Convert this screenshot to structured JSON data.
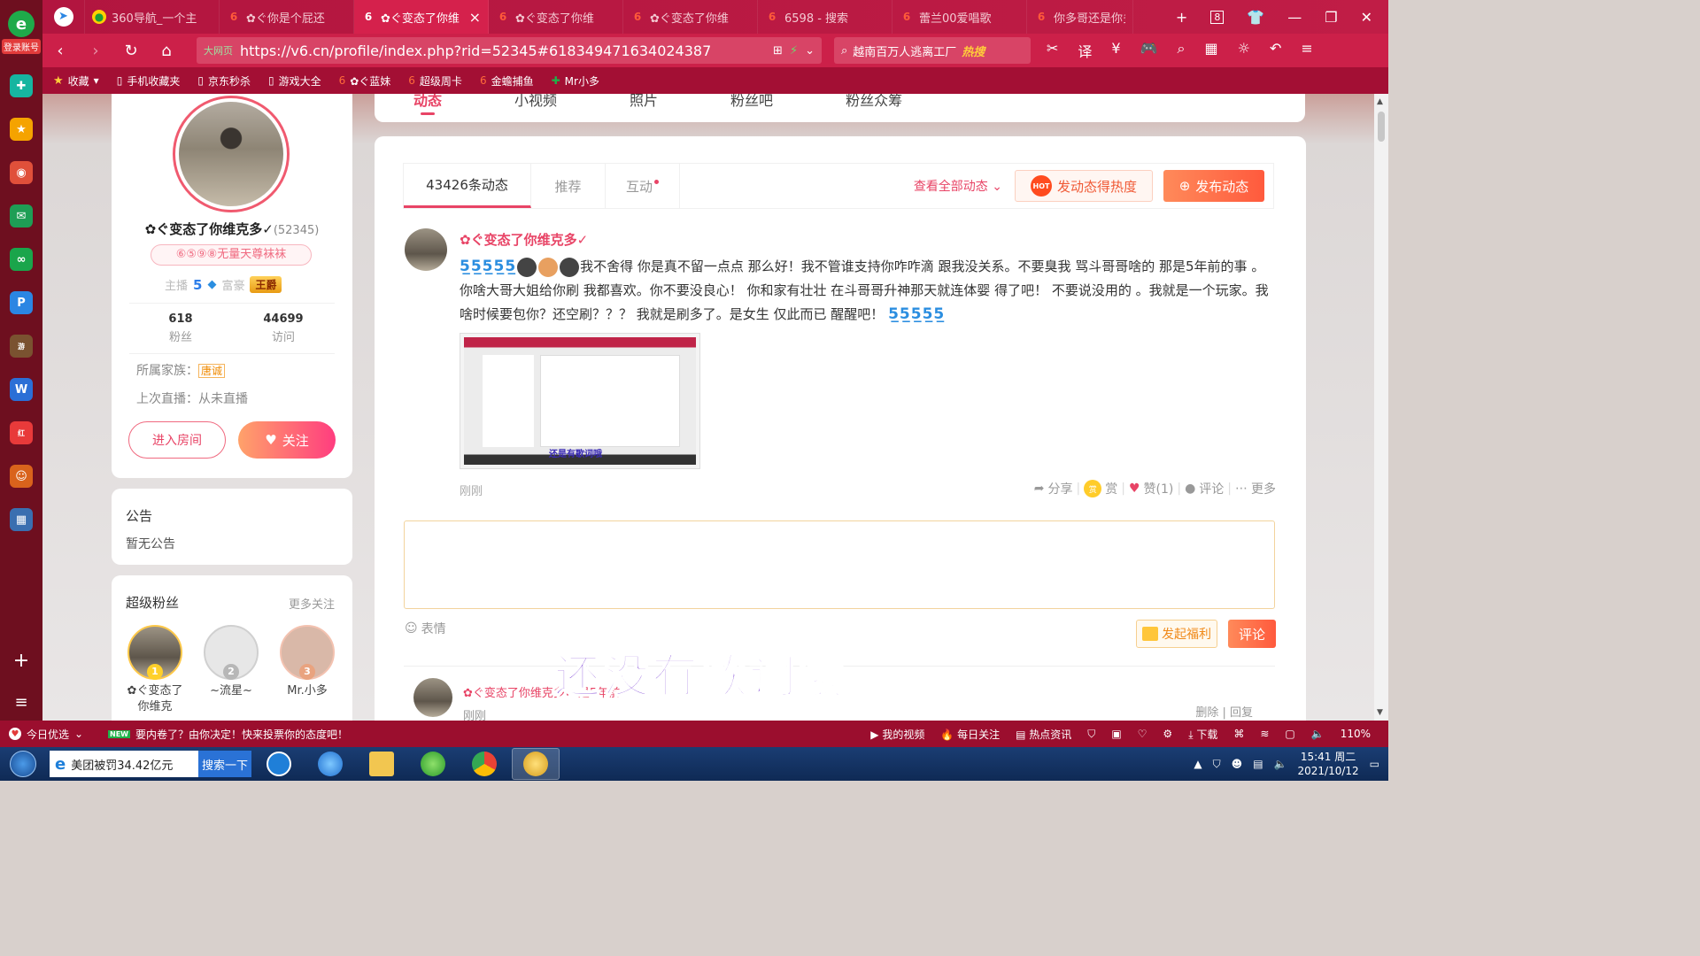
{
  "browser": {
    "tabs": [
      {
        "label": "360导航_一个主",
        "icon": "360-nav-icon",
        "active": false
      },
      {
        "label": "✿ぐ你是个屁还",
        "icon": "v6-logo-icon",
        "active": false
      },
      {
        "label": "✿ぐ变态了你维",
        "icon": "v6-logo-icon",
        "active": true
      },
      {
        "label": "✿ぐ变态了你维",
        "icon": "v6-logo-icon",
        "active": false
      },
      {
        "label": "✿ぐ变态了你维",
        "icon": "v6-logo-icon",
        "active": false
      },
      {
        "label": "6598 - 搜索",
        "icon": "v6-logo-icon",
        "active": false
      },
      {
        "label": "蕾兰00爱唱歌",
        "icon": "v6-logo-icon",
        "active": false
      },
      {
        "label": "你多哥还是你多",
        "icon": "v6-logo-icon",
        "active": false
      }
    ],
    "tab_count_badge": "8",
    "url": "https://v6.cn/profile/index.php?rid=52345#618349471634024387",
    "secure_label": "大网页",
    "search_text": "越南百万人逃离工厂",
    "search_hot": "热搜",
    "bookmarks": [
      {
        "label": "收藏"
      },
      {
        "label": "手机收藏夹"
      },
      {
        "label": "京东秒杀"
      },
      {
        "label": "游戏大全"
      },
      {
        "label": "✿ぐ蓝妹"
      },
      {
        "label": "超级周卡"
      },
      {
        "label": "金蟾捕鱼"
      },
      {
        "label": "Mr小多"
      }
    ],
    "sidebar_login": "登录账号"
  },
  "top_nav": {
    "tabs": [
      "动态",
      "小视频",
      "照片",
      "粉丝吧",
      "粉丝众筹"
    ]
  },
  "profile": {
    "name": "✿ぐ变态了你维克多✓",
    "rid": "(52345)",
    "badge": "⑥⑤⑨⑧无量天尊袜袜",
    "anchor_label": "主播",
    "anchor_level": "5",
    "rich_label": "富豪",
    "rich_title": "王爵",
    "stats": [
      {
        "num": "618",
        "label": "粉丝"
      },
      {
        "num": "44699",
        "label": "访问"
      }
    ],
    "family_label": "所属家族：",
    "family_name": "唐诚",
    "last_live": "上次直播：从未直播",
    "enter_room": "进入房间",
    "follow": "关注"
  },
  "notice": {
    "title": "公告",
    "content": "暂无公告"
  },
  "super_fans": {
    "title": "超级粉丝",
    "more": "更多关注",
    "fans": [
      {
        "rank": "1",
        "name": "✿ぐ变态了你维克"
      },
      {
        "rank": "2",
        "name": "~流星~"
      },
      {
        "rank": "3",
        "name": "Mr.小多"
      }
    ]
  },
  "feed": {
    "tabs": [
      "43426条动态",
      "推荐",
      "互动"
    ],
    "view_all": "查看全部动态",
    "hot_button": "发动态得热度",
    "hot_icon_text": "HOT",
    "post_button": "发布动态",
    "post": {
      "author": "✿ぐ变态了你维克多✓",
      "text": "我不舍得 你是真不留一点点 那么好！我不管谁支持你咋咋滴 跟我没关系。不要臭我 骂斗哥哥啥的 那是5年前的事 。你啥大哥大姐给你刷 我都喜欢。你不要没良心！ 你和家有壮壮 在斗哥哥升神那天就连体婴 得了吧！ 不要说没用的 。我就是一个玩家。我啥时候要包你？还空刷？？？ 我就是刷多了。是女生 仅此而已 醒醒吧！",
      "image_caption": "还是有歌词哦",
      "time": "刚刚",
      "actions": {
        "share": "分享",
        "reward": "赏",
        "like": "赞(1)",
        "comment": "评论",
        "more": "更多"
      }
    },
    "emoji_label": "表情",
    "welfare_button": "发起福利",
    "comment_button": "评论",
    "reply": {
      "name": "✿ぐ变态了你维克多✓ 是5年前",
      "time": "刚刚",
      "actions": "删除 | 回复"
    },
    "overlay": "还没有歌词哦"
  },
  "statusbar": {
    "left": "今日优选",
    "news": "要内卷了？由你决定！快来投票你的态度吧！",
    "items": [
      "我的视频",
      "每日关注",
      "热点资讯",
      "下载",
      "110%"
    ]
  },
  "taskbar": {
    "search_value": "美团被罚34.42亿元",
    "search_button": "搜索一下",
    "time": "15:41 周二",
    "date": "2021/10/12"
  },
  "colors": {
    "accent": "#e84466",
    "browser_red": "#c01d46",
    "post_orange": "#ff5a3d"
  }
}
